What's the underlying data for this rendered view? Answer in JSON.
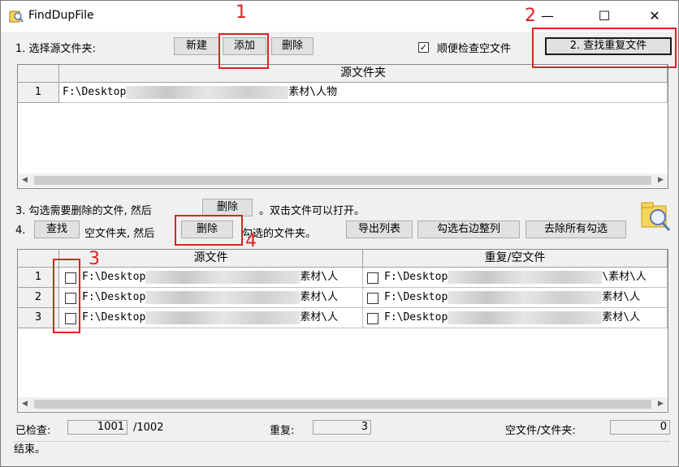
{
  "window": {
    "title": "FindDupFile",
    "minimize": "—",
    "maximize": "☐",
    "close": "✕"
  },
  "step1": {
    "label": "1. 选择源文件夹:",
    "new_btn": "新建",
    "add_btn": "添加",
    "delete_btn": "删除",
    "check_empty_label": "顺便检查空文件",
    "find_btn": "2. 查找重复文件"
  },
  "source_grid": {
    "header": "源文件夹",
    "rows": [
      {
        "num": "1",
        "path_prefix": "F:\\Desktop",
        "path_suffix": "素材\\人物"
      }
    ]
  },
  "step3": {
    "label_pre": "3. 勾选需要删除的文件, 然后",
    "delete_btn": "删除",
    "label_post": "。双击文件可以打开。"
  },
  "step4": {
    "label_num": "4.",
    "find_btn": "查找",
    "label_mid": "空文件夹, 然后",
    "delete_btn": "删除",
    "label_post": "勾选的文件夹。",
    "export_btn": "导出列表",
    "check_right_btn": "勾选右边整列",
    "clear_btn": "去除所有勾选"
  },
  "result_grid": {
    "col_source": "源文件",
    "col_dup": "重复/空文件",
    "rows": [
      {
        "num": "1",
        "src_prefix": "F:\\Desktop",
        "src_suffix": "素材\\人",
        "dup_prefix": "F:\\Desktop",
        "dup_suffix": "\\素材\\人"
      },
      {
        "num": "2",
        "src_prefix": "F:\\Desktop",
        "src_suffix": "素材\\人",
        "dup_prefix": "F:\\Desktop",
        "dup_suffix": "素材\\人"
      },
      {
        "num": "3",
        "src_prefix": "F:\\Desktop",
        "src_suffix": "素材\\人",
        "dup_prefix": "F:\\Desktop",
        "dup_suffix": "素材\\人"
      }
    ]
  },
  "stats": {
    "checked_label": "已检查:",
    "checked_value": "1001",
    "checked_total": "/1002",
    "dup_label": "重复:",
    "dup_value": "3",
    "empty_label": "空文件/文件夹:",
    "empty_value": "0"
  },
  "status": "结束。",
  "annotations": [
    "1",
    "2",
    "3",
    "4"
  ]
}
